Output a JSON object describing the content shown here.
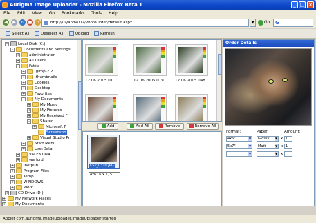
{
  "window": {
    "title": "Aurigma Image Uploader - Mozilla Firefox Beta 1",
    "minimize_glyph": "_",
    "maximize_glyph": "□",
    "close_glyph": "×"
  },
  "menu": [
    "File",
    "Edit",
    "View",
    "Go",
    "Bookmarks",
    "Tools",
    "Help"
  ],
  "nav": {
    "url": "http://ulyanov/iu2/PhotoOrder/default.aspx",
    "go_label": "Go",
    "search_logo": "G"
  },
  "toolbar": {
    "select_all": "Select All",
    "deselect_all": "Deselect All",
    "upload": "Upload",
    "refresh": "Refresh"
  },
  "tree": [
    {
      "label": "Local Disk (C:)",
      "level": 0,
      "exp": "-",
      "disk": true
    },
    {
      "label": "Documents and Settings",
      "level": 1,
      "exp": "-"
    },
    {
      "label": "administrator",
      "level": 2,
      "exp": "+"
    },
    {
      "label": "All Users",
      "level": 2,
      "exp": "+"
    },
    {
      "label": "Fattie",
      "level": 2,
      "exp": "-"
    },
    {
      "label": ".gimp-2.2",
      "level": 3,
      "exp": "+"
    },
    {
      "label": ".thumbnails",
      "level": 3,
      "exp": "+"
    },
    {
      "label": "Cookies",
      "level": 3,
      "exp": "+"
    },
    {
      "label": "Desktop",
      "level": 3,
      "exp": "+"
    },
    {
      "label": "Favorites",
      "level": 3,
      "exp": "+"
    },
    {
      "label": "My Documents",
      "level": 3,
      "exp": "-"
    },
    {
      "label": "My Music",
      "level": 4,
      "exp": "+"
    },
    {
      "label": "My Pictures",
      "level": 4,
      "exp": "+"
    },
    {
      "label": "My Received F",
      "level": 4,
      "exp": "+"
    },
    {
      "label": "Shared",
      "level": 4,
      "exp": "-"
    },
    {
      "label": "Microsoft F",
      "level": 5,
      "exp": "+"
    },
    {
      "label": "Screensho",
      "level": 5,
      "exp": "",
      "selected": true
    },
    {
      "label": "Visual Studio Pr",
      "level": 4,
      "exp": "+"
    },
    {
      "label": "Start Menu",
      "level": 3,
      "exp": "+"
    },
    {
      "label": "UserData",
      "level": 3,
      "exp": "+"
    },
    {
      "label": "VALENTINA",
      "level": 2,
      "exp": "+"
    },
    {
      "label": "warlord",
      "level": 2,
      "exp": "+"
    },
    {
      "label": "Inetpub",
      "level": 1,
      "exp": "+"
    },
    {
      "label": "Program Files",
      "level": 1,
      "exp": "+"
    },
    {
      "label": "Temp",
      "level": 1,
      "exp": "+"
    },
    {
      "label": "WINDOWS",
      "level": 1,
      "exp": "+"
    },
    {
      "label": "Work",
      "level": 1,
      "exp": "+"
    },
    {
      "label": "CD Drive (D:)",
      "level": 0,
      "exp": "+",
      "disk": true
    },
    {
      "label": "My Network Places",
      "level": -1,
      "exp": "+"
    },
    {
      "label": "My Documents",
      "level": -1,
      "exp": "+"
    }
  ],
  "thumbnails": [
    {
      "caption": "12.06.2005 01...",
      "color": "#6f8a5c"
    },
    {
      "caption": "12.06.2005 019...",
      "color": "#4b6a43"
    },
    {
      "caption": "12.06.2005 048...",
      "color": "#2a3b22"
    },
    {
      "caption": "",
      "color": "#6a4c3a"
    },
    {
      "caption": "",
      "color": "#556b7a"
    },
    {
      "caption": "",
      "color": "#8a7a55"
    }
  ],
  "actions": {
    "add": "Add",
    "add_all": "Add All",
    "remove": "Remove",
    "remove_all": "Remove All"
  },
  "selected": {
    "filename": "KSP_0310.JPG",
    "info": "4x6\" 6 x 1, 5..."
  },
  "order": {
    "header": "Order Details",
    "format_label": "Format:",
    "paper_label": "Paper:",
    "amount_label": "Amount:",
    "rows": [
      {
        "format": "4x6\"",
        "paper": "Glossy",
        "amount": "1"
      },
      {
        "format": "5x7\"",
        "paper": "Matt",
        "amount": "1"
      },
      {
        "format": "",
        "paper": "",
        "amount": ""
      }
    ],
    "times_glyph": "x"
  },
  "status": "Applet com.aurigma.imageuploader.ImageUploader started"
}
